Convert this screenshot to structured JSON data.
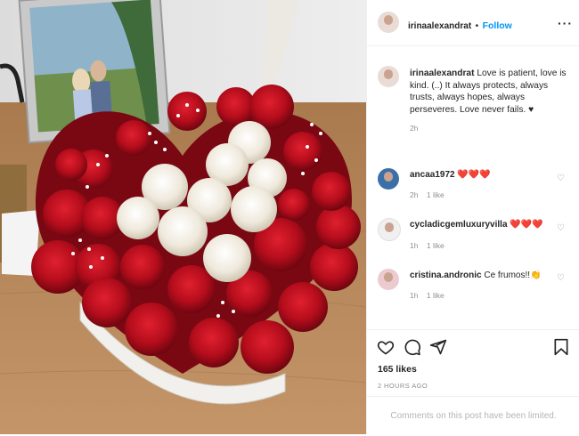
{
  "header": {
    "username": "irinaalexandrat",
    "separator": "•",
    "follow_label": "Follow",
    "more_icon": "more-horizontal-icon"
  },
  "caption": {
    "username": "irinaalexandrat",
    "text": "Love is patient, love is kind. (..) It always protects, always trusts, always hopes, always perseveres. Love never fails. ♥",
    "time": "2h"
  },
  "comments": [
    {
      "username": "ancaa1972",
      "text": "❤️❤️❤️",
      "time": "2h",
      "likes": "1 like"
    },
    {
      "username": "cycladicgemluxuryvilla",
      "text": "❤️❤️❤️",
      "time": "1h",
      "likes": "1 like"
    },
    {
      "username": "cristina.andronic",
      "text": "Ce frumos!!👏",
      "time": "1h",
      "likes": "1 like"
    }
  ],
  "actions": {
    "like_icon": "heart-icon",
    "comment_icon": "comment-icon",
    "share_icon": "send-icon",
    "save_icon": "bookmark-icon"
  },
  "likes_label": "165 likes",
  "posted_ago": "2 HOURS AGO",
  "comments_limited": "Comments on this post have been limited.",
  "colors": {
    "link": "#0095f6",
    "text": "#262626",
    "muted": "#8e8e8e",
    "rose_red": "#c8102e",
    "rose_white": "#f3eee2"
  }
}
